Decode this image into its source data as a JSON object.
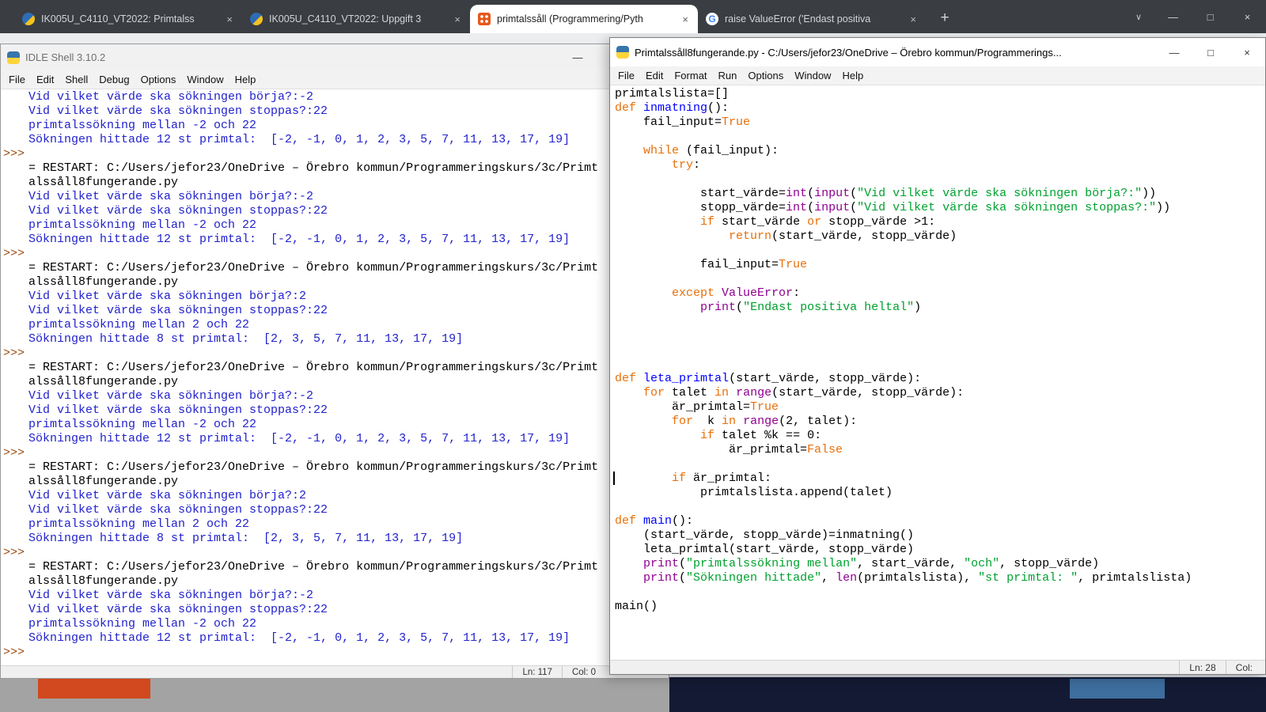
{
  "colors": {
    "kw": "#e8700a",
    "builtin": "#900090",
    "str": "#00a12f",
    "defname": "#0000ff",
    "out": "#2222cc",
    "prompt": "#9c4b0e"
  },
  "browser": {
    "tabs": [
      {
        "label": "IK005U_C4110_VT2022: Primtalss",
        "icon": "moodle",
        "active": false
      },
      {
        "label": "IK005U_C4110_VT2022: Uppgift 3",
        "icon": "moodle",
        "active": false
      },
      {
        "label": "primtalssåll (Programmering/Pyth",
        "icon": "forum",
        "active": true
      },
      {
        "label": "raise ValueError ('Endast positiva",
        "icon": "google",
        "active": false
      }
    ],
    "icons": {
      "google_letter": "G"
    },
    "controls": {
      "new_tab": "+",
      "close_tab": "×",
      "chevron": "∨",
      "minimize": "—",
      "maximize": "□",
      "close": "×"
    }
  },
  "window_controls": {
    "minimize": "—",
    "maximize": "□",
    "close": "×"
  },
  "shell": {
    "title": "IDLE Shell 3.10.2",
    "menu": [
      "File",
      "Edit",
      "Shell",
      "Debug",
      "Options",
      "Window",
      "Help"
    ],
    "prompt_glyph": ">>>",
    "status_ln": "Ln: 117",
    "status_col": "Col: 0",
    "lines": [
      {
        "p": 0,
        "c": "out",
        "t": "Vid vilket värde ska sökningen börja?:-2"
      },
      {
        "p": 0,
        "c": "out",
        "t": "Vid vilket värde ska sökningen stoppas?:22"
      },
      {
        "p": 0,
        "c": "out",
        "t": "primtalssökning mellan -2 och 22"
      },
      {
        "p": 0,
        "c": "out",
        "t": "Sökningen hittade 12 st primtal:  [-2, -1, 0, 1, 2, 3, 5, 7, 11, 13, 17, 19]"
      },
      {
        "p": 1,
        "c": "rst",
        "t": ""
      },
      {
        "p": 0,
        "c": "rst",
        "t": "= RESTART: C:/Users/jefor23/OneDrive – Örebro kommun/Programmeringskurs/3c/Primt"
      },
      {
        "p": 0,
        "c": "rst",
        "t": "alssåll8fungerande.py"
      },
      {
        "p": 0,
        "c": "out",
        "t": "Vid vilket värde ska sökningen börja?:-2"
      },
      {
        "p": 0,
        "c": "out",
        "t": "Vid vilket värde ska sökningen stoppas?:22"
      },
      {
        "p": 0,
        "c": "out",
        "t": "primtalssökning mellan -2 och 22"
      },
      {
        "p": 0,
        "c": "out",
        "t": "Sökningen hittade 12 st primtal:  [-2, -1, 0, 1, 2, 3, 5, 7, 11, 13, 17, 19]"
      },
      {
        "p": 1,
        "c": "rst",
        "t": ""
      },
      {
        "p": 0,
        "c": "rst",
        "t": "= RESTART: C:/Users/jefor23/OneDrive – Örebro kommun/Programmeringskurs/3c/Primt"
      },
      {
        "p": 0,
        "c": "rst",
        "t": "alssåll8fungerande.py"
      },
      {
        "p": 0,
        "c": "out",
        "t": "Vid vilket värde ska sökningen börja?:2"
      },
      {
        "p": 0,
        "c": "out",
        "t": "Vid vilket värde ska sökningen stoppas?:22"
      },
      {
        "p": 0,
        "c": "out",
        "t": "primtalssökning mellan 2 och 22"
      },
      {
        "p": 0,
        "c": "out",
        "t": "Sökningen hittade 8 st primtal:  [2, 3, 5, 7, 11, 13, 17, 19]"
      },
      {
        "p": 1,
        "c": "rst",
        "t": ""
      },
      {
        "p": 0,
        "c": "rst",
        "t": "= RESTART: C:/Users/jefor23/OneDrive – Örebro kommun/Programmeringskurs/3c/Primt"
      },
      {
        "p": 0,
        "c": "rst",
        "t": "alssåll8fungerande.py"
      },
      {
        "p": 0,
        "c": "out",
        "t": "Vid vilket värde ska sökningen börja?:-2"
      },
      {
        "p": 0,
        "c": "out",
        "t": "Vid vilket värde ska sökningen stoppas?:22"
      },
      {
        "p": 0,
        "c": "out",
        "t": "primtalssökning mellan -2 och 22"
      },
      {
        "p": 0,
        "c": "out",
        "t": "Sökningen hittade 12 st primtal:  [-2, -1, 0, 1, 2, 3, 5, 7, 11, 13, 17, 19]"
      },
      {
        "p": 1,
        "c": "rst",
        "t": ""
      },
      {
        "p": 0,
        "c": "rst",
        "t": "= RESTART: C:/Users/jefor23/OneDrive – Örebro kommun/Programmeringskurs/3c/Primt"
      },
      {
        "p": 0,
        "c": "rst",
        "t": "alssåll8fungerande.py"
      },
      {
        "p": 0,
        "c": "out",
        "t": "Vid vilket värde ska sökningen börja?:2"
      },
      {
        "p": 0,
        "c": "out",
        "t": "Vid vilket värde ska sökningen stoppas?:22"
      },
      {
        "p": 0,
        "c": "out",
        "t": "primtalssökning mellan 2 och 22"
      },
      {
        "p": 0,
        "c": "out",
        "t": "Sökningen hittade 8 st primtal:  [2, 3, 5, 7, 11, 13, 17, 19]"
      },
      {
        "p": 1,
        "c": "rst",
        "t": ""
      },
      {
        "p": 0,
        "c": "rst",
        "t": "= RESTART: C:/Users/jefor23/OneDrive – Örebro kommun/Programmeringskurs/3c/Primt"
      },
      {
        "p": 0,
        "c": "rst",
        "t": "alssåll8fungerande.py"
      },
      {
        "p": 0,
        "c": "out",
        "t": "Vid vilket värde ska sökningen börja?:-2"
      },
      {
        "p": 0,
        "c": "out",
        "t": "Vid vilket värde ska sökningen stoppas?:22"
      },
      {
        "p": 0,
        "c": "out",
        "t": "primtalssökning mellan -2 och 22"
      },
      {
        "p": 0,
        "c": "out",
        "t": "Sökningen hittade 12 st primtal:  [-2, -1, 0, 1, 2, 3, 5, 7, 11, 13, 17, 19]"
      },
      {
        "p": 1,
        "c": "rst",
        "t": ""
      }
    ]
  },
  "editor": {
    "title": "Primtalssåll8fungerande.py - C:/Users/jefor23/OneDrive – Örebro kommun/Programmerings...",
    "menu": [
      "File",
      "Edit",
      "Format",
      "Run",
      "Options",
      "Window",
      "Help"
    ],
    "status_ln": "Ln: 28",
    "status_col": "Col:",
    "code": [
      [
        [
          "primtalslista=[]",
          "n"
        ]
      ],
      [
        [
          "def",
          "k"
        ],
        [
          " ",
          "n"
        ],
        [
          "inmatning",
          "d"
        ],
        [
          "():",
          "n"
        ]
      ],
      [
        [
          "    fail_input=",
          "n"
        ],
        [
          "True",
          "k"
        ]
      ],
      [],
      [
        [
          "    ",
          "n"
        ],
        [
          "while",
          "k"
        ],
        [
          " (fail_input):",
          "n"
        ]
      ],
      [
        [
          "        ",
          "n"
        ],
        [
          "try",
          "k"
        ],
        [
          ":",
          "n"
        ]
      ],
      [],
      [
        [
          "            start_värde=",
          "n"
        ],
        [
          "int",
          "b"
        ],
        [
          "(",
          "n"
        ],
        [
          "input",
          "b"
        ],
        [
          "(",
          "n"
        ],
        [
          "\"Vid vilket värde ska sökningen börja?:\"",
          "s"
        ],
        [
          "))",
          "n"
        ]
      ],
      [
        [
          "            stopp_värde=",
          "n"
        ],
        [
          "int",
          "b"
        ],
        [
          "(",
          "n"
        ],
        [
          "input",
          "b"
        ],
        [
          "(",
          "n"
        ],
        [
          "\"Vid vilket värde ska sökningen stoppas?:\"",
          "s"
        ],
        [
          "))",
          "n"
        ]
      ],
      [
        [
          "            ",
          "n"
        ],
        [
          "if",
          "k"
        ],
        [
          " start_värde ",
          "n"
        ],
        [
          "or",
          "k"
        ],
        [
          " stopp_värde >1:",
          "n"
        ]
      ],
      [
        [
          "                ",
          "n"
        ],
        [
          "return",
          "k"
        ],
        [
          "(start_värde, stopp_värde)",
          "n"
        ]
      ],
      [],
      [
        [
          "            fail_input=",
          "n"
        ],
        [
          "True",
          "k"
        ]
      ],
      [],
      [
        [
          "        ",
          "n"
        ],
        [
          "except",
          "k"
        ],
        [
          " ",
          "n"
        ],
        [
          "ValueError",
          "b"
        ],
        [
          ":",
          "n"
        ]
      ],
      [
        [
          "            ",
          "n"
        ],
        [
          "print",
          "b"
        ],
        [
          "(",
          "n"
        ],
        [
          "\"Endast positiva heltal\"",
          "s"
        ],
        [
          ")",
          "n"
        ]
      ],
      [],
      [],
      [],
      [],
      [
        [
          "def",
          "k"
        ],
        [
          " ",
          "n"
        ],
        [
          "leta_primtal",
          "d"
        ],
        [
          "(start_värde, stopp_värde):",
          "n"
        ]
      ],
      [
        [
          "    ",
          "n"
        ],
        [
          "for",
          "k"
        ],
        [
          " talet ",
          "n"
        ],
        [
          "in",
          "k"
        ],
        [
          " ",
          "n"
        ],
        [
          "range",
          "b"
        ],
        [
          "(start_värde, stopp_värde):",
          "n"
        ]
      ],
      [
        [
          "        är_primtal=",
          "n"
        ],
        [
          "True",
          "k"
        ]
      ],
      [
        [
          "        ",
          "n"
        ],
        [
          "for",
          "k"
        ],
        [
          "  k ",
          "n"
        ],
        [
          "in",
          "k"
        ],
        [
          " ",
          "n"
        ],
        [
          "range",
          "b"
        ],
        [
          "(2, talet):",
          "n"
        ]
      ],
      [
        [
          "            ",
          "n"
        ],
        [
          "if",
          "k"
        ],
        [
          " talet %k == 0:",
          "n"
        ]
      ],
      [
        [
          "                är_primtal=",
          "n"
        ],
        [
          "False",
          "k"
        ]
      ],
      [],
      [
        [
          "        ",
          "n"
        ],
        [
          "if",
          "k"
        ],
        [
          " är_primtal:",
          "n"
        ]
      ],
      [
        [
          "            primtalslista.append(talet)",
          "n"
        ]
      ],
      [],
      [
        [
          "def",
          "k"
        ],
        [
          " ",
          "n"
        ],
        [
          "main",
          "d"
        ],
        [
          "():",
          "n"
        ]
      ],
      [
        [
          "    (start_värde, stopp_värde)=inmatning()",
          "n"
        ]
      ],
      [
        [
          "    leta_primtal(start_värde, stopp_värde)",
          "n"
        ]
      ],
      [
        [
          "    ",
          "n"
        ],
        [
          "print",
          "b"
        ],
        [
          "(",
          "n"
        ],
        [
          "\"primtalssökning mellan\"",
          "s"
        ],
        [
          ", start_värde, ",
          "n"
        ],
        [
          "\"och\"",
          "s"
        ],
        [
          ", stopp_värde)",
          "n"
        ]
      ],
      [
        [
          "    ",
          "n"
        ],
        [
          "print",
          "b"
        ],
        [
          "(",
          "n"
        ],
        [
          "\"Sökningen hittade\"",
          "s"
        ],
        [
          ", ",
          "n"
        ],
        [
          "len",
          "b"
        ],
        [
          "(primtalslista), ",
          "n"
        ],
        [
          "\"st primtal: \"",
          "s"
        ],
        [
          ", primtalslista)",
          "n"
        ]
      ],
      [],
      [
        [
          "main()",
          "n"
        ]
      ]
    ]
  }
}
